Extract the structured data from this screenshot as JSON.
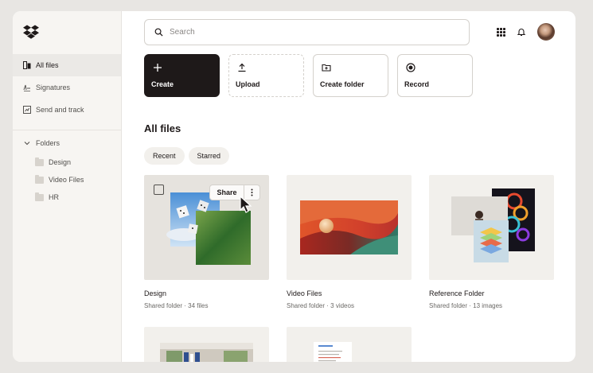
{
  "sidebar": {
    "logo": "dropbox-logo",
    "nav": [
      {
        "label": "All files",
        "icon": "files-icon",
        "active": true
      },
      {
        "label": "Signatures",
        "icon": "signature-icon",
        "active": false
      },
      {
        "label": "Send and track",
        "icon": "send-track-icon",
        "active": false
      }
    ],
    "folders_header": "Folders",
    "folders": [
      {
        "label": "Design"
      },
      {
        "label": "Video Files"
      },
      {
        "label": "HR"
      }
    ]
  },
  "header": {
    "search_placeholder": "Search"
  },
  "actions": [
    {
      "label": "Create",
      "icon": "plus-icon"
    },
    {
      "label": "Upload",
      "icon": "upload-icon"
    },
    {
      "label": "Create folder",
      "icon": "create-folder-icon"
    },
    {
      "label": "Record",
      "icon": "record-icon"
    }
  ],
  "main": {
    "title": "All files",
    "chips": [
      "Recent",
      "Starred"
    ],
    "share_label": "Share",
    "cards": [
      {
        "name": "Design",
        "meta": "Shared folder · 34 files"
      },
      {
        "name": "Video Files",
        "meta": "Shared folder · 3 videos"
      },
      {
        "name": "Reference Folder",
        "meta": "Shared folder · 13 images"
      }
    ]
  },
  "colors": {
    "primary": "#1e1919",
    "sidebar_bg": "#f7f5f2",
    "card_bg": "#f2f0ec"
  }
}
